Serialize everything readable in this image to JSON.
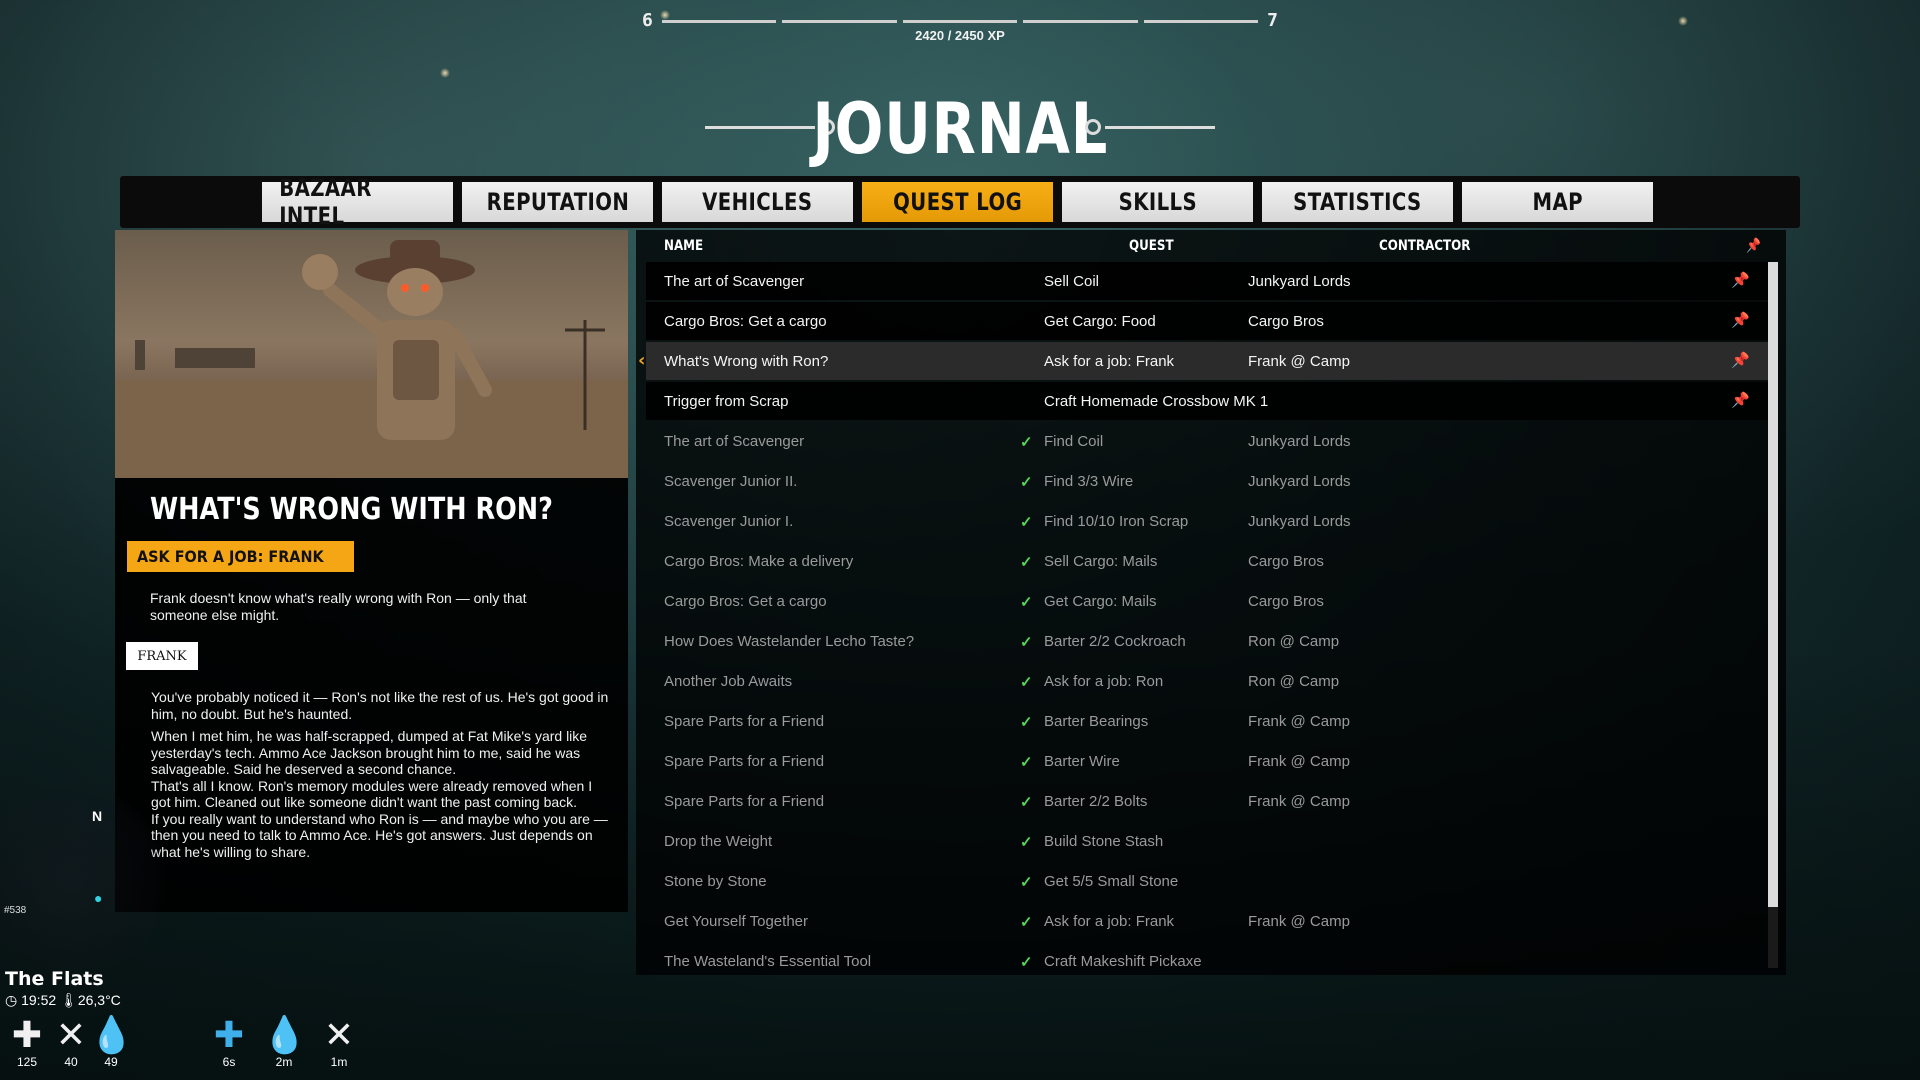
{
  "xp": {
    "level_current": "6",
    "level_next": "7",
    "progress": "2420 / 2450 XP"
  },
  "title": "JOURNAL",
  "tabs": [
    {
      "label": "BAZAAR INTEL"
    },
    {
      "label": "REPUTATION"
    },
    {
      "label": "VEHICLES"
    },
    {
      "label": "QUEST LOG",
      "active": true
    },
    {
      "label": "SKILLS"
    },
    {
      "label": "STATISTICS"
    },
    {
      "label": "MAP"
    }
  ],
  "detail": {
    "heading": "WHAT'S WRONG WITH RON?",
    "quest_tag": "ASK FOR A JOB: FRANK",
    "summary": "Frank doesn't know what's really wrong with Ron — only that someone else might.",
    "speaker": "FRANK",
    "dialog": [
      "You've probably noticed it — Ron's not like the rest of us. He's got good in him, no doubt. But he's haunted.",
      "When I met him, he was half-scrapped, dumped at Fat Mike's yard like yesterday's tech. Ammo Ace Jackson brought him to me, said he was salvageable. Said he deserved a second chance.",
      "That's all I know. Ron's memory modules were already removed when I got him. Cleaned out like someone didn't want the past coming back.",
      "If you really want to understand who Ron is — and maybe who you are — then you need to talk to Ammo Ace. He's got answers. Just depends on what he's willing to share."
    ]
  },
  "table": {
    "headers": {
      "name": "NAME",
      "quest": "QUEST",
      "contractor": "CONTRACTOR"
    },
    "rows": [
      {
        "name": "The art of Scavenger",
        "quest": "Sell Coil",
        "contractor": "Junkyard Lords",
        "status": "active",
        "pinned": true,
        "pin_color": "#ffffff"
      },
      {
        "name": "Cargo Bros: Get a cargo",
        "quest": "Get Cargo: Food",
        "contractor": "Cargo Bros",
        "status": "active",
        "pinned": true
      },
      {
        "name": "What's Wrong with Ron?",
        "quest": "Ask for a job: Frank",
        "contractor": "Frank @ Camp",
        "status": "active",
        "pinned": true,
        "selected": true
      },
      {
        "name": "Trigger from Scrap",
        "quest": "Craft Homemade Crossbow MK 1",
        "contractor": "",
        "status": "active",
        "pinned": true
      },
      {
        "name": "The art of Scavenger",
        "quest": "Find Coil",
        "contractor": "Junkyard Lords",
        "status": "done"
      },
      {
        "name": "Scavenger Junior II.",
        "quest": "Find 3/3 Wire",
        "contractor": "Junkyard Lords",
        "status": "done"
      },
      {
        "name": "Scavenger Junior I.",
        "quest": "Find 10/10 Iron Scrap",
        "contractor": "Junkyard Lords",
        "status": "done"
      },
      {
        "name": "Cargo Bros: Make a delivery",
        "quest": "Sell Cargo: Mails",
        "contractor": "Cargo Bros",
        "status": "done"
      },
      {
        "name": "Cargo Bros: Get a cargo",
        "quest": "Get Cargo: Mails",
        "contractor": "Cargo Bros",
        "status": "done"
      },
      {
        "name": "How Does Wastelander Lecho Taste?",
        "quest": "Barter 2/2 Cockroach",
        "contractor": "Ron @ Camp",
        "status": "done"
      },
      {
        "name": "Another Job Awaits",
        "quest": "Ask for a job: Ron",
        "contractor": "Ron @ Camp",
        "status": "done"
      },
      {
        "name": "Spare Parts for a Friend",
        "quest": "Barter Bearings",
        "contractor": "Frank @ Camp",
        "status": "done"
      },
      {
        "name": "Spare Parts for a Friend",
        "quest": "Barter Wire",
        "contractor": "Frank @ Camp",
        "status": "done"
      },
      {
        "name": "Spare Parts for a Friend",
        "quest": "Barter 2/2 Bolts",
        "contractor": "Frank @ Camp",
        "status": "done"
      },
      {
        "name": "Drop the Weight",
        "quest": "Build Stone Stash",
        "contractor": "",
        "status": "done"
      },
      {
        "name": "Stone by Stone",
        "quest": "Get 5/5 Small Stone",
        "contractor": "",
        "status": "done"
      },
      {
        "name": "Get Yourself Together",
        "quest": "Ask for a job: Frank",
        "contractor": "Frank @ Camp",
        "status": "done"
      },
      {
        "name": "The Wasteland's Essential Tool",
        "quest": "Craft Makeshift Pickaxe",
        "contractor": "",
        "status": "done"
      }
    ]
  },
  "hud": {
    "compass_n": "N",
    "coords": "#538",
    "location": "The Flats",
    "time": "19:52",
    "temperature": "26,3°C",
    "stats": [
      {
        "icon": "health-icon",
        "glyph": "✚",
        "value": "125"
      },
      {
        "icon": "food-icon",
        "glyph": "✕",
        "value": "40"
      },
      {
        "icon": "water-icon",
        "glyph": "💧",
        "value": "49"
      },
      {
        "icon": "heal-buff-icon",
        "glyph": "✚",
        "value": "6s",
        "color": "#3fb0ea"
      },
      {
        "icon": "hydration-buff-icon",
        "glyph": "💧",
        "value": "2m"
      },
      {
        "icon": "food-buff-icon",
        "glyph": "✕",
        "value": "1m"
      }
    ]
  }
}
